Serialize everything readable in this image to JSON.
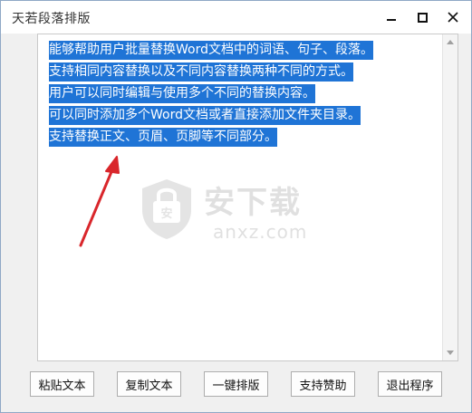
{
  "window": {
    "title": "天若段落排版"
  },
  "editor": {
    "lines": [
      "能够帮助用户批量替换Word文档中的词语、句子、段落。",
      "支持相同内容替换以及不同内容替换两种不同的方式。",
      "用户可以同时编辑与使用多个不同的替换内容。",
      "可以同时添加多个Word文档或者直接添加文件夹目录。",
      "支持替换正文、页眉、页脚等不同部分。"
    ],
    "selection_color": "#1f74d6"
  },
  "watermark": {
    "cn": "安下载",
    "en": "anxz.com",
    "icon": "shield-lock-icon"
  },
  "buttons": {
    "paste": "粘贴文本",
    "copy": "复制文本",
    "format": "一键排版",
    "support": "支持赞助",
    "exit": "退出程序"
  },
  "colors": {
    "annotation_arrow": "#d9262b"
  }
}
